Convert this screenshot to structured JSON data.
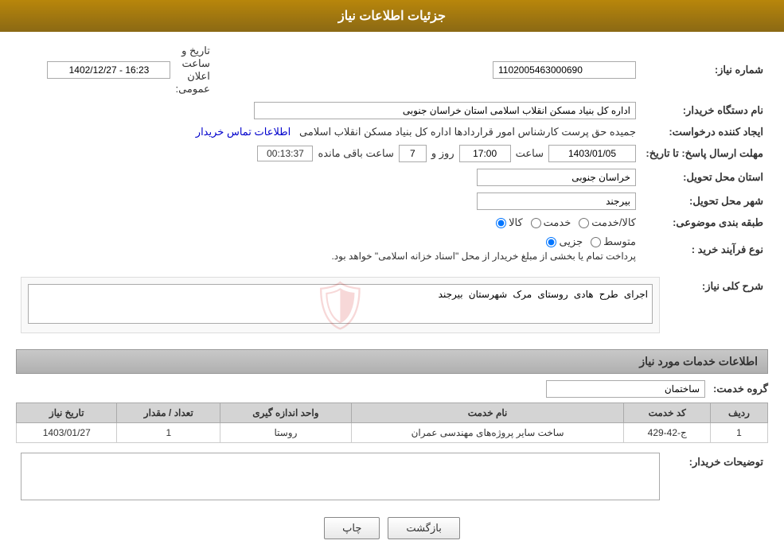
{
  "header": {
    "title": "جزئیات اطلاعات نیاز"
  },
  "fields": {
    "need_number_label": "شماره نیاز:",
    "need_number_value": "1102005463000690",
    "org_label": "نام دستگاه خریدار:",
    "org_value": "اداره کل بنیاد مسکن انقلاب اسلامی استان خراسان جنوبی",
    "creator_label": "ایجاد کننده درخواست:",
    "creator_value": "جمیده حق پرست کارشناس امور قراردادها اداره کل بنیاد مسکن انقلاب اسلامی",
    "contact_link": "اطلاعات تماس خریدار",
    "deadline_label": "مهلت ارسال پاسخ: تا تاریخ:",
    "deadline_date": "1403/01/05",
    "deadline_time_label": "ساعت",
    "deadline_time": "17:00",
    "deadline_days_label": "روز و",
    "deadline_days": "7",
    "deadline_remaining_label": "ساعت باقی مانده",
    "deadline_remaining": "00:13:37",
    "province_label": "استان محل تحویل:",
    "province_value": "خراسان جنوبی",
    "city_label": "شهر محل تحویل:",
    "city_value": "بیرجند",
    "category_label": "طبقه بندی موضوعی:",
    "category_kala": "کالا",
    "category_khedmat": "خدمت",
    "category_kala_khedmat": "کالا/خدمت",
    "proc_type_label": "نوع فرآیند خرید :",
    "proc_type_jozee": "جزیی",
    "proc_type_motevaset": "متوسط",
    "proc_note": "پرداخت تمام یا بخشی از مبلغ خریدار از محل \"اسناد خزانه اسلامی\" خواهد بود.",
    "announce_label": "تاریخ و ساعت اعلان عمومی:",
    "announce_value": "1402/12/27 - 16:23",
    "description_section": "شرح کلی نیاز:",
    "description_value": "اجرای طرح هادی روستای مرک شهرستان بیرجند",
    "services_section": "اطلاعات خدمات مورد نیاز",
    "service_group_label": "گروه خدمت:",
    "service_group_value": "ساختمان",
    "table_headers": {
      "row": "ردیف",
      "code": "کد خدمت",
      "name": "نام خدمت",
      "unit": "واحد اندازه گیری",
      "count": "تعداد / مقدار",
      "date": "تاریخ نیاز"
    },
    "table_rows": [
      {
        "row": "1",
        "code": "ج-42-429",
        "name": "ساخت سایر پروژه‌های مهندسی عمران",
        "unit": "روستا",
        "count": "1",
        "date": "1403/01/27"
      }
    ],
    "buyer_notes_label": "توضیحات خریدار:",
    "buyer_notes_value": ""
  },
  "buttons": {
    "print": "چاپ",
    "back": "بازگشت"
  }
}
